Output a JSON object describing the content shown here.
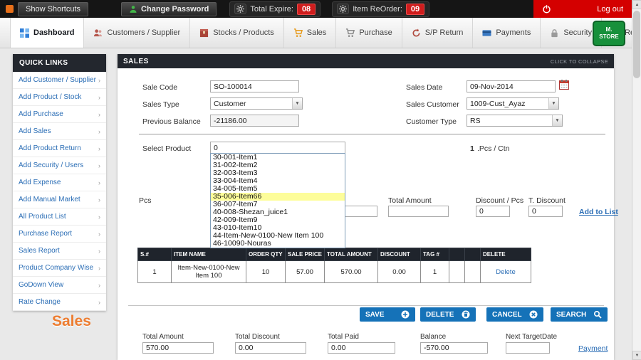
{
  "colors": {
    "accent_blue": "#1572b8",
    "header_dark": "#23272e",
    "badge_red": "#cf1d1d",
    "logout_red": "#d40000",
    "link_blue": "#2a6db5",
    "highlight_yellow": "#fdfd9a",
    "watermark_orange": "#ed7d31",
    "logo_green": "#17903b"
  },
  "icons": {
    "chevron_right": "›",
    "select_arrow": "▼",
    "scroll_up": "▲",
    "scroll_down": "▼"
  },
  "topbar": {
    "show_shortcuts": "Show Shortcuts",
    "change_password": "Change Password",
    "total_expire_label": "Total Expire:",
    "total_expire_value": "08",
    "item_reorder_label": "Item ReOrder:",
    "item_reorder_value": "09",
    "logout": "Log out"
  },
  "nav": {
    "logo": "M. STORE",
    "tabs": [
      {
        "label": "Dashboard",
        "icon": "dashboard-icon"
      },
      {
        "label": "Customers / Supplier",
        "icon": "customers-icon"
      },
      {
        "label": "Stocks / Products",
        "icon": "stocks-icon"
      },
      {
        "label": "Sales",
        "icon": "sales-cart-icon"
      },
      {
        "label": "Purchase",
        "icon": "purchase-cart-icon"
      },
      {
        "label": "S/P Return",
        "icon": "return-icon"
      },
      {
        "label": "Payments",
        "icon": "payments-icon"
      },
      {
        "label": "Security",
        "icon": "lock-icon"
      },
      {
        "label": "Reports",
        "icon": "reports-icon"
      }
    ]
  },
  "sidebar": {
    "header": "QUICK LINKS",
    "items": [
      "Add Customer / Supplier",
      "Add Product / Stock",
      "Add Purchase",
      "Add Sales",
      "Add Product Return",
      "Add Security / Users",
      "Add Expense",
      "Add Manual Market",
      "All Product List",
      "Purchase Report",
      "Sales Report",
      "Product Company Wise",
      "GoDown View",
      "Rate Change"
    ]
  },
  "main": {
    "panel_title": "SALES",
    "collapse_label": "CLICK TO COLLAPSE",
    "watermark": "Sales",
    "form": {
      "sale_code_label": "Sale Code",
      "sale_code": "SO-100014",
      "sales_date_label": "Sales Date",
      "sales_date": "09-Nov-2014",
      "sales_type_label": "Sales Type",
      "sales_type": "Customer",
      "sales_customer_label": "Sales Customer",
      "sales_customer": "1009-Cust_Ayaz",
      "previous_balance_label": "Previous Balance",
      "previous_balance": "-21186.00",
      "customer_type_label": "Customer Type",
      "customer_type": "RS",
      "select_product_label": "Select Product",
      "select_product_value": "0",
      "pcs_ctn_qty": "1",
      "pcs_ctn_unit": ".Pcs / Ctn",
      "pcs_label": "Pcs",
      "total_amount_label": "Total Amount",
      "discount_pcs_label": "Discount / Pcs",
      "t_discount_label": "T. Discount",
      "sale_price_value": "",
      "total_amount_value": "",
      "discount_pcs_value": "0",
      "t_discount_value": "0",
      "add_to_list": "Add to List"
    },
    "dropdown": {
      "items": [
        "30-001-Item1",
        "31-002-Item2",
        "32-003-Item3",
        "33-004-Item4",
        "34-005-Item5",
        "35-006-Item66",
        "36-007-Item7",
        "40-008-Shezan_juice1",
        "42-009-Item9",
        "43-010-Item10",
        "44-Item-New-0100-New Item 100",
        "46-10090-Nouras"
      ],
      "highlighted": "35-006-Item66"
    },
    "table": {
      "headers": [
        "S.#",
        "ITEM NAME",
        "ORDER QTY",
        "SALE PRICE",
        "TOTAL AMOUNT",
        "DISCOUNT",
        "TAG #",
        "",
        "",
        "DELETE"
      ],
      "rows": [
        {
          "sn": "1",
          "item": "Item-New-0100-New Item 100",
          "qty": "10",
          "price": "57.00",
          "total": "570.00",
          "discount": "0.00",
          "tag": "1",
          "delete": "Delete"
        }
      ]
    },
    "buttons": {
      "save": "SAVE",
      "delete": "DELETE",
      "cancel": "CANCEL",
      "search": "SEARCH"
    },
    "footer": {
      "total_amount_label": "Total Amount",
      "total_amount": "570.00",
      "total_discount_label": "Total Discount",
      "total_discount": "0.00",
      "total_paid_label": "Total Paid",
      "total_paid": "0.00",
      "balance_label": "Balance",
      "balance": "-570.00",
      "next_target_label": "Next TargetDate",
      "next_target": "",
      "payment_link": "Payment"
    }
  }
}
